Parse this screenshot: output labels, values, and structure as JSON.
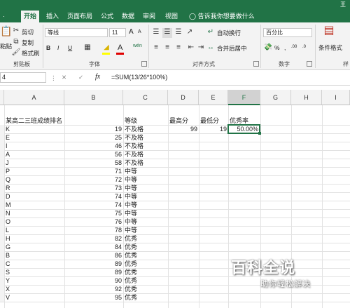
{
  "ribbon_tabs": [
    "开始",
    "插入",
    "页面布局",
    "公式",
    "数据",
    "审阅",
    "视图"
  ],
  "tell_me": "告诉我你想要做什么",
  "user": "王",
  "clipboard": {
    "paste": "粘贴",
    "cut": "剪切",
    "copy": "复制",
    "format_painter": "格式刷",
    "label": "剪贴板"
  },
  "font": {
    "name": "等线",
    "size": "11",
    "label": "字体",
    "bold": "B",
    "italic": "I",
    "underline": "U",
    "grow": "A",
    "shrink": "A",
    "wen": "wén"
  },
  "alignment": {
    "wrap": "自动换行",
    "merge": "合并后居中",
    "label": "对齐方式"
  },
  "number": {
    "format": "百分比",
    "label": "数字",
    "percent": "%",
    "comma": ",",
    "inc": ".00",
    "dec": ".0"
  },
  "styles": {
    "conditional": "条件格式",
    "label": "样"
  },
  "formula_bar": {
    "name_box": "4",
    "fx": "fx",
    "cancel": "✕",
    "enter": "✓",
    "formula": "=SUM(13/26*100%)"
  },
  "columns": [
    "A",
    "B",
    "C",
    "D",
    "E",
    "F",
    "G",
    "H",
    "I"
  ],
  "sheet": {
    "title": "某高二三班成绩排名",
    "grade_header": "等级",
    "max_header": "最高分",
    "min_header": "最低分",
    "rate_header": "优秀率",
    "max_value": "99",
    "min_value": "19",
    "rate_value": "50.00%",
    "rows": [
      {
        "name": "K",
        "score": "19",
        "grade": "不及格"
      },
      {
        "name": "E",
        "score": "25",
        "grade": "不及格"
      },
      {
        "name": "I",
        "score": "46",
        "grade": "不及格"
      },
      {
        "name": "A",
        "score": "56",
        "grade": "不及格"
      },
      {
        "name": "J",
        "score": "58",
        "grade": "不及格"
      },
      {
        "name": "P",
        "score": "71",
        "grade": "中等"
      },
      {
        "name": "Q",
        "score": "72",
        "grade": "中等"
      },
      {
        "name": "R",
        "score": "73",
        "grade": "中等"
      },
      {
        "name": "D",
        "score": "74",
        "grade": "中等"
      },
      {
        "name": "M",
        "score": "74",
        "grade": "中等"
      },
      {
        "name": "N",
        "score": "75",
        "grade": "中等"
      },
      {
        "name": "O",
        "score": "76",
        "grade": "中等"
      },
      {
        "name": "L",
        "score": "78",
        "grade": "中等"
      },
      {
        "name": "H",
        "score": "82",
        "grade": "优秀"
      },
      {
        "name": "G",
        "score": "84",
        "grade": "优秀"
      },
      {
        "name": "B",
        "score": "86",
        "grade": "优秀"
      },
      {
        "name": "C",
        "score": "89",
        "grade": "优秀"
      },
      {
        "name": "S",
        "score": "89",
        "grade": "优秀"
      },
      {
        "name": "Y",
        "score": "90",
        "grade": "优秀"
      },
      {
        "name": "X",
        "score": "92",
        "grade": "优秀"
      },
      {
        "name": "V",
        "score": "95",
        "grade": "优秀"
      }
    ]
  },
  "watermark": {
    "title": "百科全说",
    "subtitle": "助你轻松解决"
  }
}
